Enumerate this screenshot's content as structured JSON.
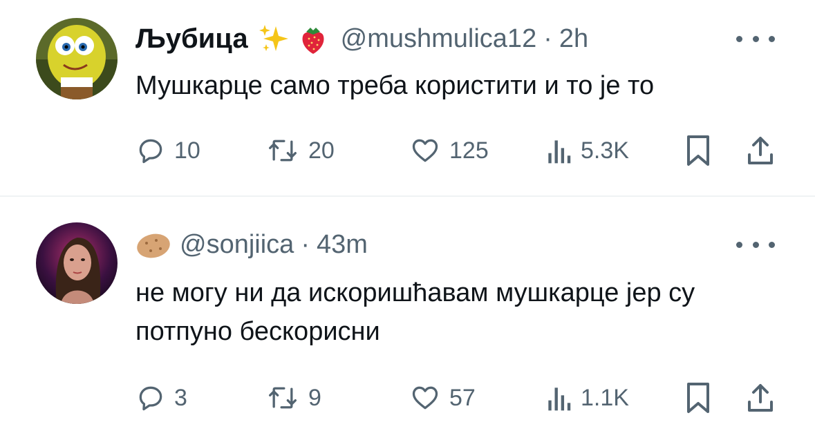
{
  "tweets": [
    {
      "display_name": "Љубица",
      "name_emojis": [
        "sparkles-emoji",
        "strawberry-emoji"
      ],
      "handle": "@mushmulica12",
      "separator": "·",
      "time": "2h",
      "text": "Мушкарце само треба користити и то је то",
      "counts": {
        "replies": "10",
        "reposts": "20",
        "likes": "125",
        "views": "5.3K"
      },
      "avatar_icon": "spongebob-avatar"
    },
    {
      "display_name": "",
      "name_emojis": [
        "potato-emoji"
      ],
      "handle": "@sonjiica",
      "separator": "·",
      "time": "43m",
      "text": "не могу ни да искоришћавам мушкарце јер су потпуно бескорисни",
      "counts": {
        "replies": "3",
        "reposts": "9",
        "likes": "57",
        "views": "1.1K"
      },
      "avatar_icon": "woman-portrait-avatar"
    }
  ],
  "colors": {
    "text_primary": "#0f1419",
    "text_secondary": "#536471",
    "divider": "#eff3f4"
  }
}
